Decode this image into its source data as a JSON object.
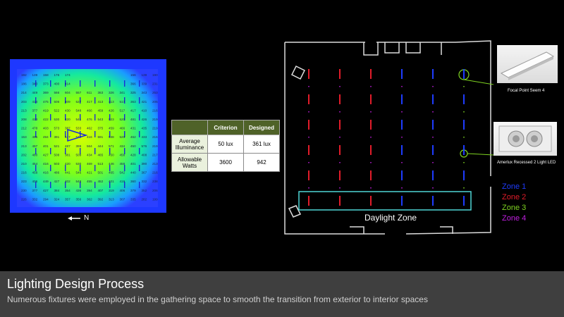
{
  "heatmap": {
    "values": [
      [
        "192",
        "139",
        "158",
        "176",
        "174",
        "—",
        "—",
        "—",
        "—",
        "—",
        "156",
        "139",
        "190"
      ],
      [
        "186",
        "343",
        "373",
        "400",
        "414",
        "—",
        "—",
        "—",
        "—",
        "—",
        "366",
        "339",
        "231"
      ],
      [
        "214",
        "449",
        "369",
        "566",
        "604",
        "557",
        "611",
        "363",
        "326",
        "341",
        "325",
        "343",
        "253"
      ],
      [
        "203",
        "414",
        "475",
        "506",
        "409",
        "527",
        "417",
        "413",
        "413",
        "517",
        "363",
        "421",
        "205"
      ],
      [
        "213",
        "377",
        "419",
        "522",
        "430",
        "548",
        "466",
        "459",
        "426",
        "517",
        "417",
        "410",
        "216"
      ],
      [
        "208",
        "413",
        "422",
        "530",
        "420",
        "541",
        "476",
        "543",
        "523",
        "520",
        "481",
        "426",
        "219"
      ],
      [
        "212",
        "478",
        "403",
        "573",
        "387",
        "533",
        "462",
        "375",
        "459",
        "466",
        "431",
        "435",
        "219"
      ],
      [
        "153",
        "495",
        "494",
        "391",
        "517",
        "540",
        "416",
        "591",
        "538",
        "520",
        "462",
        "433",
        "216"
      ],
      [
        "213",
        "497",
        "401",
        "521",
        "487",
        "399",
        "564",
        "444",
        "571",
        "434",
        "450",
        "576",
        "219"
      ],
      [
        "202",
        "480",
        "427",
        "508",
        "381",
        "509",
        "434",
        "465",
        "450",
        "456",
        "428",
        "408",
        "217"
      ],
      [
        "210",
        "454",
        "416",
        "503",
        "420",
        "530",
        "469",
        "513",
        "446",
        "458",
        "401",
        "390",
        "213"
      ],
      [
        "216",
        "458",
        "416",
        "486",
        "441",
        "546",
        "421",
        "501",
        "465",
        "542",
        "440",
        "367",
        "216"
      ],
      [
        "223",
        "406",
        "449",
        "427",
        "402",
        "548",
        "455",
        "452",
        "401",
        "419",
        "360",
        "332",
        "238"
      ],
      [
        "230",
        "377",
        "427",
        "384",
        "354",
        "436",
        "394",
        "407",
        "319",
        "406",
        "379",
        "352",
        "206"
      ],
      [
        "226",
        "332",
        "294",
        "324",
        "357",
        "356",
        "362",
        "392",
        "313",
        "307",
        "335",
        "282",
        "199"
      ]
    ]
  },
  "north_label": "N",
  "criteria_table": {
    "headers": [
      "",
      "Criterion",
      "Designed"
    ],
    "rows": [
      {
        "label": "Average Illuminance",
        "criterion": "50 lux",
        "designed": "361 lux"
      },
      {
        "label": "Allowable Watts",
        "criterion": "3600",
        "designed": "942"
      }
    ]
  },
  "fixtures": {
    "focal_caption": "Focal Point Seem 4",
    "amerlux_caption": "Amerlux Recessed 2 Light LED"
  },
  "zones": {
    "zone1": "Zone 1",
    "zone2": "Zone 2",
    "zone3": "Zone 3",
    "zone4": "Zone 4",
    "colors": {
      "zone1": "#1e3cff",
      "zone2": "#e21c2a",
      "zone3": "#7ed321",
      "zone4": "#c11ee0",
      "daylight_box": "#4fd6d6"
    }
  },
  "daylight_zone_label": "Daylight Zone",
  "caption": {
    "title": "Lighting Design Process",
    "subtitle": "Numerous fixtures were employed in the gathering space to smooth the transition from exterior to interior spaces"
  }
}
